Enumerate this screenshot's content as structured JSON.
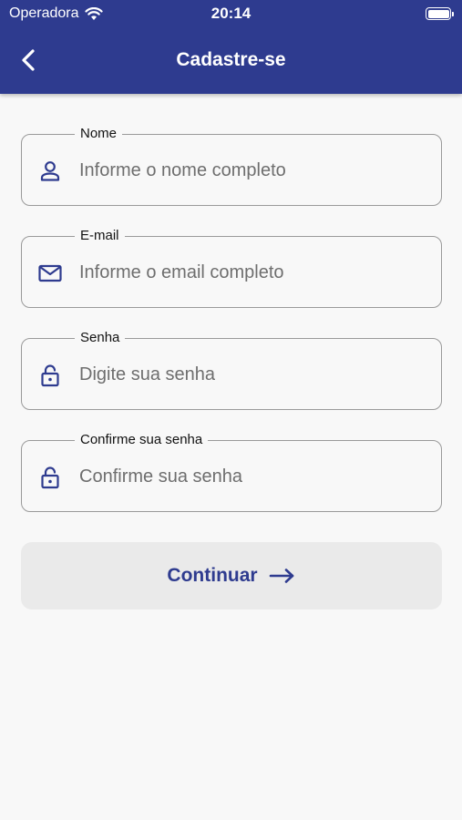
{
  "status_bar": {
    "carrier": "Operadora",
    "time": "20:14"
  },
  "header": {
    "title": "Cadastre-se"
  },
  "form": {
    "fields": [
      {
        "label": "Nome",
        "placeholder": "Informe o nome completo",
        "icon": "person-icon"
      },
      {
        "label": "E-mail",
        "placeholder": "Informe o email completo",
        "icon": "mail-icon"
      },
      {
        "label": "Senha",
        "placeholder": "Digite sua senha",
        "icon": "lock-icon"
      },
      {
        "label": "Confirme sua senha",
        "placeholder": "Confirme sua senha",
        "icon": "lock-icon"
      }
    ],
    "submit_label": "Continuar"
  },
  "colors": {
    "primary": "#2e3b8f",
    "background": "#f8f8f8",
    "button_bg": "#eaeaea"
  }
}
